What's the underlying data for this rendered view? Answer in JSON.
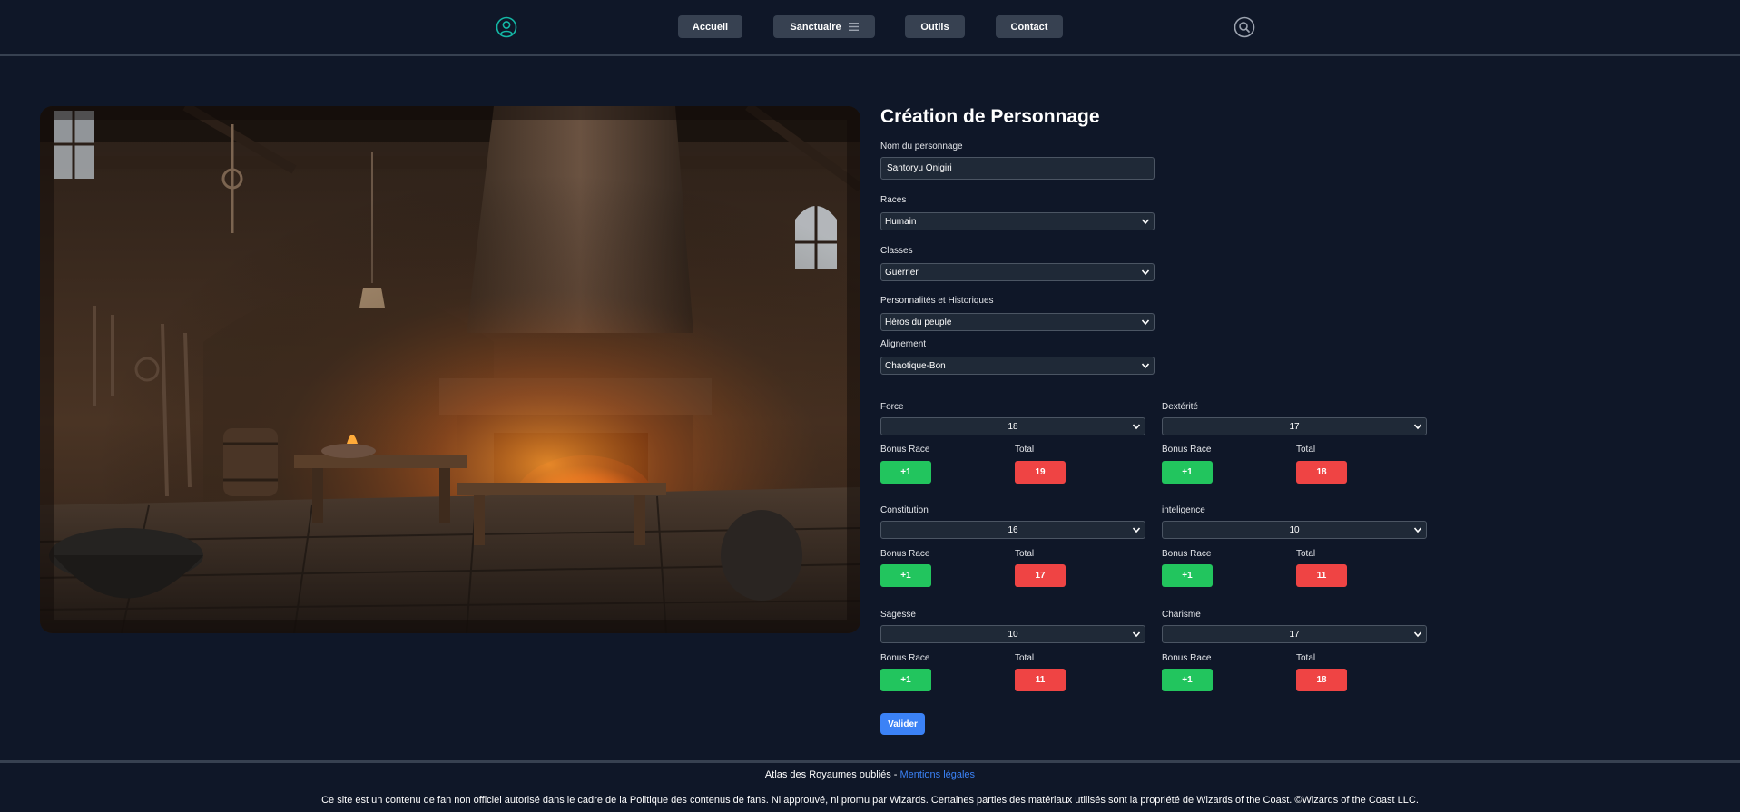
{
  "nav": {
    "items": [
      {
        "label": "Accueil"
      },
      {
        "label": "Sanctuaire"
      },
      {
        "label": "Outils"
      },
      {
        "label": "Contact"
      }
    ],
    "icons": {
      "user": "user-icon",
      "menu": "menu-icon",
      "search": "search-icon"
    },
    "accent_color": "#14b8a6"
  },
  "hero": {
    "icon": "forge-illustration"
  },
  "form": {
    "title": "Création de Personnage",
    "name_label": "Nom du personnage",
    "name_value": "Santoryu Onigiri",
    "race_label": "Races",
    "race_value": "Humain",
    "class_label": "Classes",
    "class_value": "Guerrier",
    "background_label": "Personnalités et Historiques",
    "background_value": "Héros du peuple",
    "alignment_label": "Alignement",
    "alignment_value": "Chaotique-Bon",
    "bonus_label": "Bonus Race",
    "total_label": "Total",
    "stats": [
      {
        "label": "Force",
        "value": "18",
        "bonus": "+1",
        "total": "19"
      },
      {
        "label": "Dextérité",
        "value": "17",
        "bonus": "+1",
        "total": "18"
      },
      {
        "label": "Constitution",
        "value": "16",
        "bonus": "+1",
        "total": "17"
      },
      {
        "label": "inteligence",
        "value": "10",
        "bonus": "+1",
        "total": "11"
      },
      {
        "label": "Sagesse",
        "value": "10",
        "bonus": "+1",
        "total": "11"
      },
      {
        "label": "Charisme",
        "value": "17",
        "bonus": "+1",
        "total": "18"
      }
    ],
    "submit_label": "Valider"
  },
  "footer": {
    "site_name": "Atlas des Royaumes oubliés - ",
    "legal_link": "Mentions légales",
    "disclaimer": "Ce site est un contenu de fan non officiel autorisé dans le cadre de la Politique des contenus de fans. Ni approuvé, ni promu par Wizards. Certaines parties des matériaux utilisés sont la propriété de Wizards of the Coast. ©Wizards of the Coast LLC."
  },
  "colors": {
    "background": "#0f1728",
    "bonus": "#22c55e",
    "total": "#ef4444",
    "submit": "#3b82f6"
  }
}
